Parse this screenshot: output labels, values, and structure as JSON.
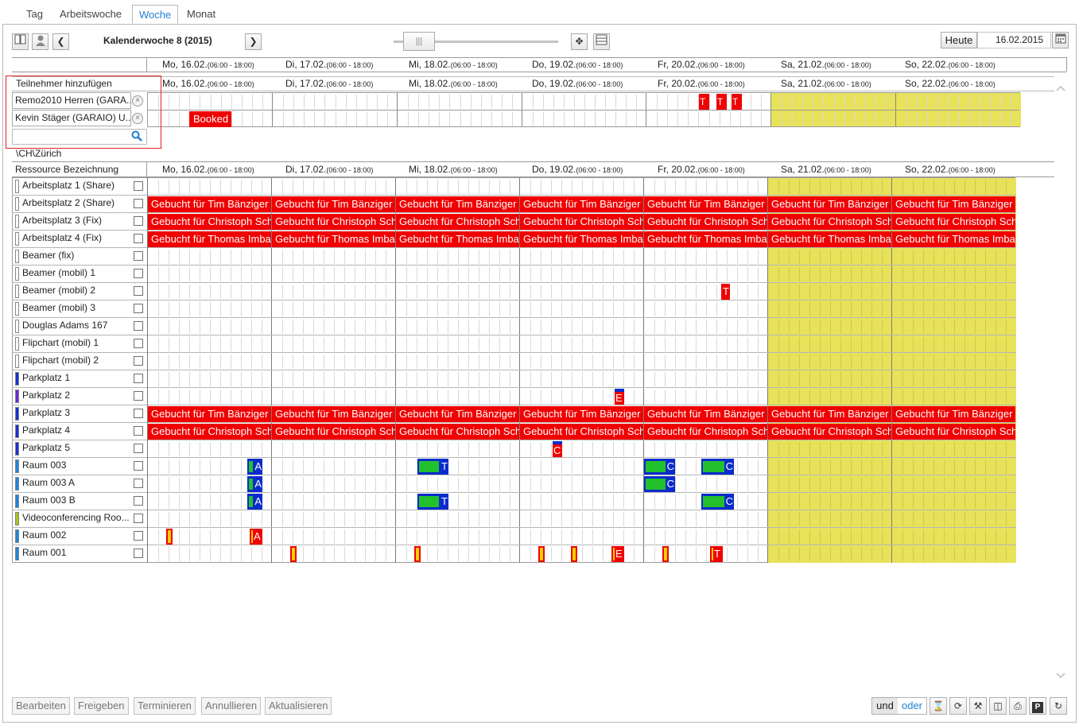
{
  "tabs": [
    {
      "label": "Tag",
      "active": false
    },
    {
      "label": "Arbeitswoche",
      "active": false
    },
    {
      "label": "Woche",
      "active": true
    },
    {
      "label": "Monat",
      "active": false
    }
  ],
  "toolbar": {
    "week_title": "Kalenderwoche 8 (2015)",
    "today_label": "Heute",
    "date_value": "16.02.2015"
  },
  "days": [
    {
      "label": "Mo, 16.02.",
      "range": "(06:00 - 18:00)",
      "weekend": false
    },
    {
      "label": "Di, 17.02.",
      "range": "(06:00 - 18:00)",
      "weekend": false
    },
    {
      "label": "Mi, 18.02.",
      "range": "(06:00 - 18:00)",
      "weekend": false
    },
    {
      "label": "Do, 19.02.",
      "range": "(06:00 - 18:00)",
      "weekend": false
    },
    {
      "label": "Fr, 20.02.",
      "range": "(06:00 - 18:00)",
      "weekend": false
    },
    {
      "label": "Sa, 21.02.",
      "range": "(06:00 - 18:00)",
      "weekend": true
    },
    {
      "label": "So, 22.02.",
      "range": "(06:00 - 18:00)",
      "weekend": true
    }
  ],
  "participants": {
    "header": "Teilnehmer hinzufügen",
    "people": [
      "Remo2010 Herren (GARA...",
      "Kevin Stäger (GARAIO) U..."
    ],
    "search_placeholder": "",
    "events": [
      {
        "row": 0,
        "day": 4,
        "start": 0.42,
        "end": 0.5,
        "text": "T",
        "kind": "red"
      },
      {
        "row": 0,
        "day": 4,
        "start": 0.56,
        "end": 0.64,
        "text": "T",
        "kind": "red"
      },
      {
        "row": 0,
        "day": 4,
        "start": 0.68,
        "end": 0.76,
        "text": "T",
        "kind": "red"
      },
      {
        "row": 1,
        "day": 0,
        "start": 0.33,
        "end": 0.67,
        "text": "Booked",
        "kind": "red"
      }
    ]
  },
  "location": "\\CH\\Zürich",
  "resource_header": "Ressource Bezeichnung",
  "resources": [
    {
      "name": "Arbeitsplatz 1 (Share)",
      "color": "#ffffff"
    },
    {
      "name": "Arbeitsplatz 2 (Share)",
      "color": "#ffffff"
    },
    {
      "name": "Arbeitsplatz 3 (Fix)",
      "color": "#ffffff"
    },
    {
      "name": "Arbeitsplatz 4 (Fix)",
      "color": "#ffffff"
    },
    {
      "name": "Beamer (fix)",
      "color": "#ffffff"
    },
    {
      "name": "Beamer (mobil) 1",
      "color": "#ffffff"
    },
    {
      "name": "Beamer (mobil) 2",
      "color": "#ffffff"
    },
    {
      "name": "Beamer (mobil) 3",
      "color": "#ffffff"
    },
    {
      "name": "Douglas Adams 167",
      "color": "#ffffff"
    },
    {
      "name": "Flipchart (mobil) 1",
      "color": "#ffffff"
    },
    {
      "name": "Flipchart (mobil) 2",
      "color": "#ffffff"
    },
    {
      "name": "Parkplatz 1",
      "color": "#1a2fd0"
    },
    {
      "name": "Parkplatz 2",
      "color": "#6a2ad8"
    },
    {
      "name": "Parkplatz 3",
      "color": "#1a2fd0"
    },
    {
      "name": "Parkplatz 4",
      "color": "#1a2fd0"
    },
    {
      "name": "Parkplatz 5",
      "color": "#1a2fd0"
    },
    {
      "name": "Raum 003",
      "color": "#1a86e0"
    },
    {
      "name": "Raum 003 A",
      "color": "#1a86e0"
    },
    {
      "name": "Raum 003 B",
      "color": "#1a86e0"
    },
    {
      "name": "Videoconferencing Roo...",
      "color": "#a8c21a"
    },
    {
      "name": "Raum 002",
      "color": "#1a86e0"
    },
    {
      "name": "Raum 001",
      "color": "#1a86e0"
    }
  ],
  "allday_bookings": [
    {
      "row": 1,
      "text": "Gebucht für Tim Bänziger"
    },
    {
      "row": 2,
      "text": "Gebucht für Christoph Schwab"
    },
    {
      "row": 3,
      "text": "Gebucht für Thomas Imbach"
    },
    {
      "row": 13,
      "text": "Gebucht für Tim Bänziger"
    },
    {
      "row": 14,
      "text": "Gebucht für Christoph Schwab"
    }
  ],
  "events": [
    {
      "row": 6,
      "day": 4,
      "start": 0.62,
      "end": 0.69,
      "text": "T",
      "kind": "red"
    },
    {
      "row": 12,
      "day": 3,
      "start": 0.76,
      "end": 0.84,
      "text": "E",
      "kind": "bluered"
    },
    {
      "row": 15,
      "day": 3,
      "start": 0.26,
      "end": 0.34,
      "text": "C",
      "kind": "bluered"
    },
    {
      "row": 16,
      "day": 0,
      "start": 0.8,
      "end": 0.92,
      "text": "A",
      "kind": "bluegreen"
    },
    {
      "row": 16,
      "day": 2,
      "start": 0.17,
      "end": 0.42,
      "text": "T",
      "kind": "bluegreen"
    },
    {
      "row": 16,
      "day": 4,
      "start": 0.0,
      "end": 0.25,
      "text": "C",
      "kind": "bluegreen"
    },
    {
      "row": 16,
      "day": 4,
      "start": 0.46,
      "end": 0.72,
      "text": "C",
      "kind": "bluegreen"
    },
    {
      "row": 17,
      "day": 0,
      "start": 0.8,
      "end": 0.92,
      "text": "A",
      "kind": "bluegreen"
    },
    {
      "row": 17,
      "day": 4,
      "start": 0.0,
      "end": 0.25,
      "text": "C",
      "kind": "bluegreen"
    },
    {
      "row": 18,
      "day": 0,
      "start": 0.8,
      "end": 0.92,
      "text": "A",
      "kind": "bluegreen"
    },
    {
      "row": 18,
      "day": 2,
      "start": 0.17,
      "end": 0.42,
      "text": "T",
      "kind": "bluegreen"
    },
    {
      "row": 18,
      "day": 4,
      "start": 0.46,
      "end": 0.72,
      "text": "C",
      "kind": "bluegreen"
    },
    {
      "row": 20,
      "day": 0,
      "start": 0.15,
      "end": 0.2,
      "text": "",
      "kind": "orange"
    },
    {
      "row": 20,
      "day": 0,
      "start": 0.82,
      "end": 0.92,
      "text": "A",
      "kind": "orange"
    },
    {
      "row": 21,
      "day": 1,
      "start": 0.15,
      "end": 0.2,
      "text": "",
      "kind": "orange"
    },
    {
      "row": 21,
      "day": 2,
      "start": 0.15,
      "end": 0.2,
      "text": "",
      "kind": "orange"
    },
    {
      "row": 21,
      "day": 3,
      "start": 0.15,
      "end": 0.2,
      "text": "",
      "kind": "orange"
    },
    {
      "row": 21,
      "day": 3,
      "start": 0.41,
      "end": 0.46,
      "text": "",
      "kind": "orange"
    },
    {
      "row": 21,
      "day": 3,
      "start": 0.74,
      "end": 0.84,
      "text": "E",
      "kind": "orange"
    },
    {
      "row": 21,
      "day": 4,
      "start": 0.15,
      "end": 0.2,
      "text": "",
      "kind": "orange"
    },
    {
      "row": 21,
      "day": 4,
      "start": 0.53,
      "end": 0.63,
      "text": "T",
      "kind": "orange"
    }
  ],
  "bottom_actions": [
    "Bearbeiten",
    "Freigeben",
    "Terminieren",
    "Annullieren",
    "Aktualisieren"
  ],
  "filter": {
    "and_label": "und",
    "or_label": "oder"
  },
  "icons": [
    "book-icon",
    "person-icon",
    "chevron-left-icon",
    "chevron-right-icon",
    "move-icon",
    "calendar-view-icon",
    "calendar-icon",
    "hourglass-icon",
    "refresh-icon",
    "tools-icon",
    "columns-icon",
    "print-icon",
    "parking-icon",
    "reload-icon"
  ]
}
